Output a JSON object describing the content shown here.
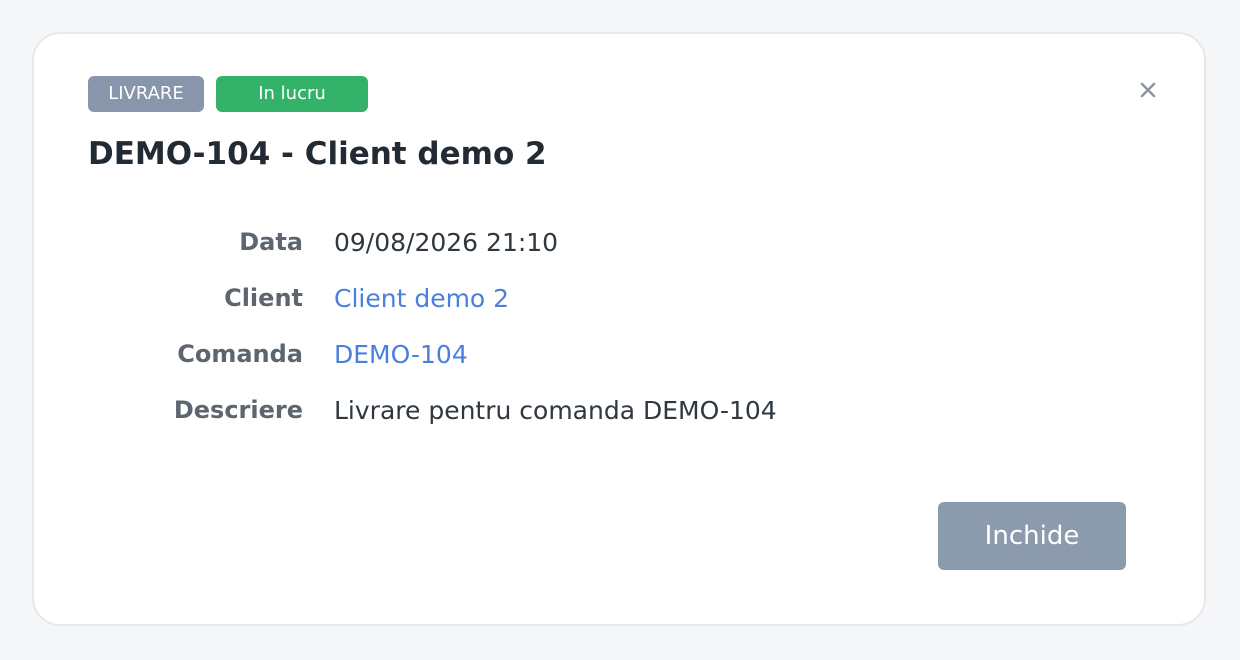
{
  "modal": {
    "type_badge": "LIVRARE",
    "status_badge": "In lucru",
    "title": "DEMO-104 - Client demo 2",
    "close_icon": "close-icon",
    "details": {
      "date_label": "Data",
      "date_value": "09/08/2026 21:10",
      "client_label": "Client",
      "client_value": "Client demo 2",
      "order_label": "Comanda",
      "order_value": "DEMO-104",
      "description_label": "Descriere",
      "description_value": "Livrare pentru comanda DEMO-104"
    },
    "close_button": "Inchide"
  },
  "colors": {
    "type_badge": "#8796aa",
    "status_badge": "#35b26a",
    "link": "#4b7fdc",
    "close_button": "#8c9aad"
  }
}
